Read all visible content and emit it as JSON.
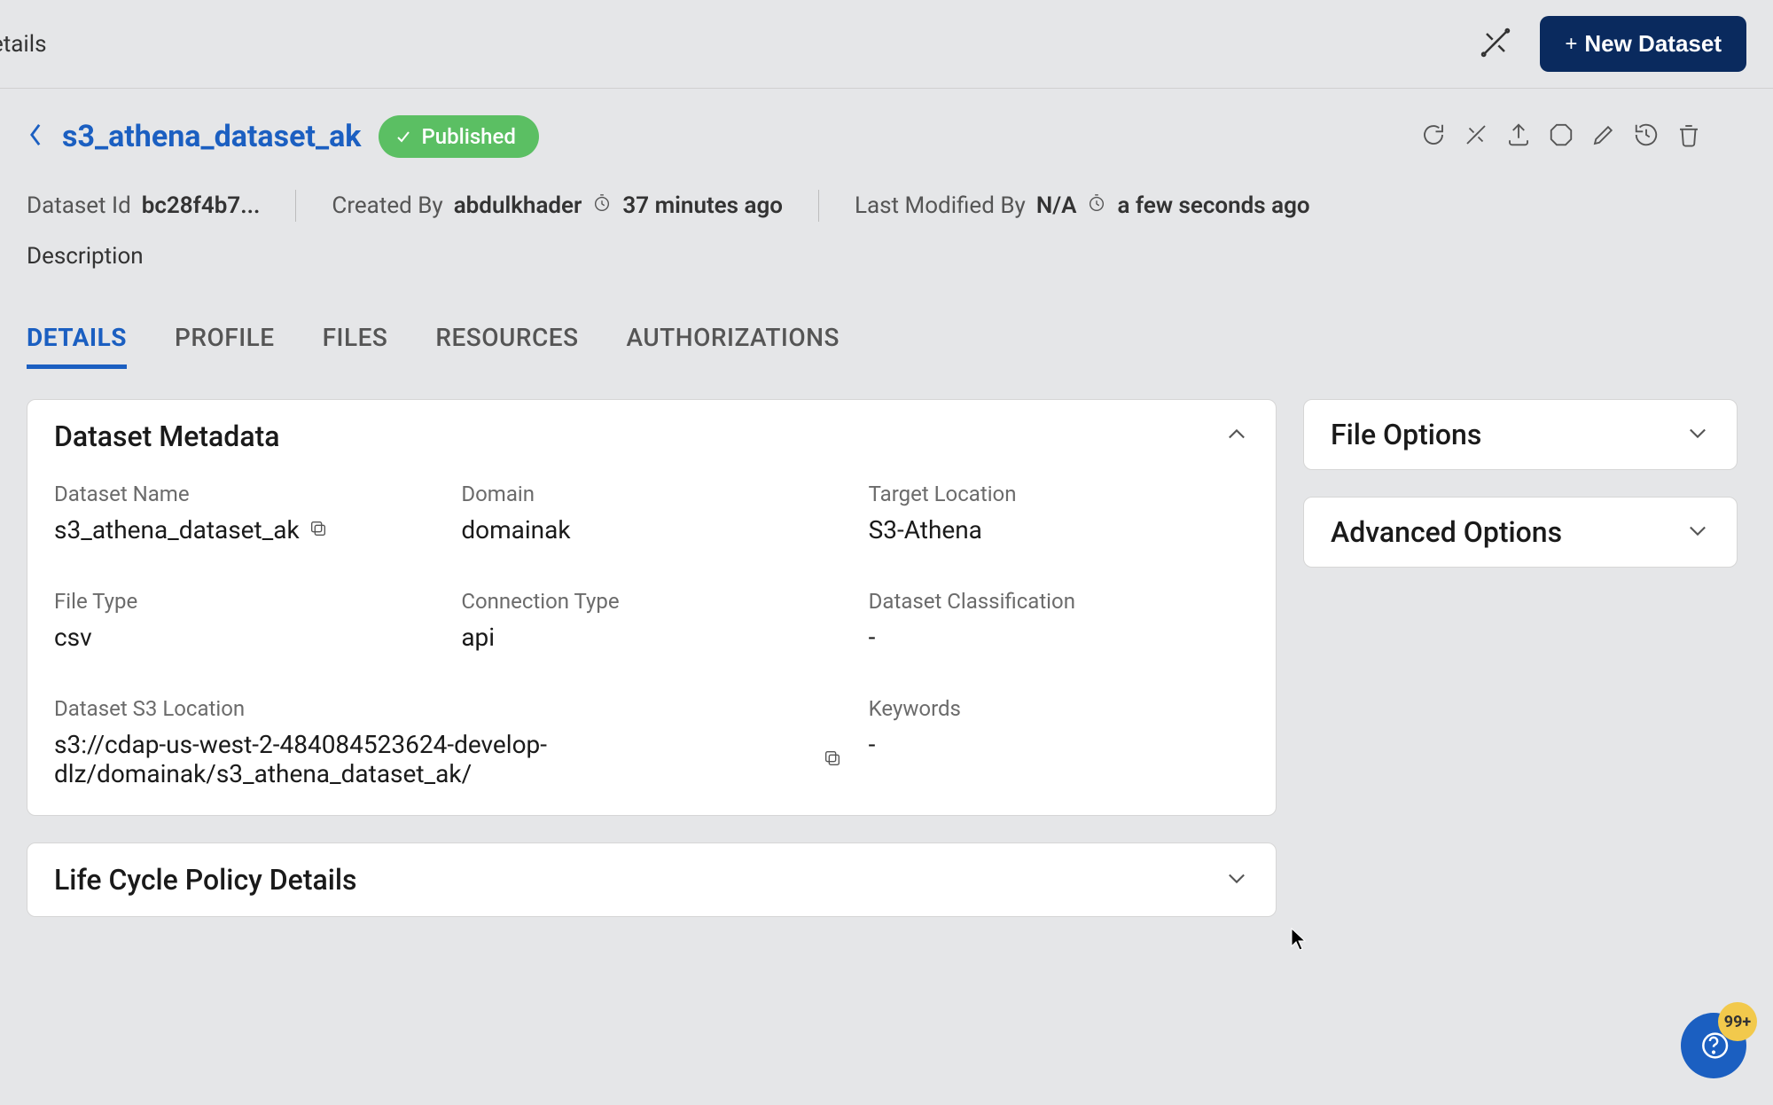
{
  "topbar": {
    "breadcrumb_fragment": "etails",
    "new_dataset_label": "New Dataset"
  },
  "header": {
    "title": "s3_athena_dataset_ak",
    "status": "Published",
    "dataset_id_label": "Dataset Id",
    "dataset_id_value": "bc28f4b7...",
    "created_by_label": "Created By",
    "created_by_value": "abdulkhader",
    "created_time": "37 minutes ago",
    "modified_by_label": "Last Modified By",
    "modified_by_value": "N/A",
    "modified_time": "a few seconds ago",
    "description_label": "Description"
  },
  "tabs": {
    "details": "DETAILS",
    "profile": "PROFILE",
    "files": "FILES",
    "resources": "RESOURCES",
    "authorizations": "AUTHORIZATIONS"
  },
  "panels": {
    "metadata_title": "Dataset Metadata",
    "lifecycle_title": "Life Cycle Policy Details",
    "file_options_title": "File Options",
    "advanced_options_title": "Advanced Options"
  },
  "metadata": {
    "dataset_name_label": "Dataset Name",
    "dataset_name_value": "s3_athena_dataset_ak",
    "domain_label": "Domain",
    "domain_value": "domainak",
    "target_location_label": "Target Location",
    "target_location_value": "S3-Athena",
    "file_type_label": "File Type",
    "file_type_value": "csv",
    "connection_type_label": "Connection Type",
    "connection_type_value": "api",
    "classification_label": "Dataset Classification",
    "classification_value": "-",
    "s3_location_label": "Dataset S3 Location",
    "s3_location_value": "s3://cdap-us-west-2-484084523624-develop-dlz/domainak/s3_athena_dataset_ak/",
    "keywords_label": "Keywords",
    "keywords_value": "-"
  },
  "help": {
    "badge": "99+"
  }
}
